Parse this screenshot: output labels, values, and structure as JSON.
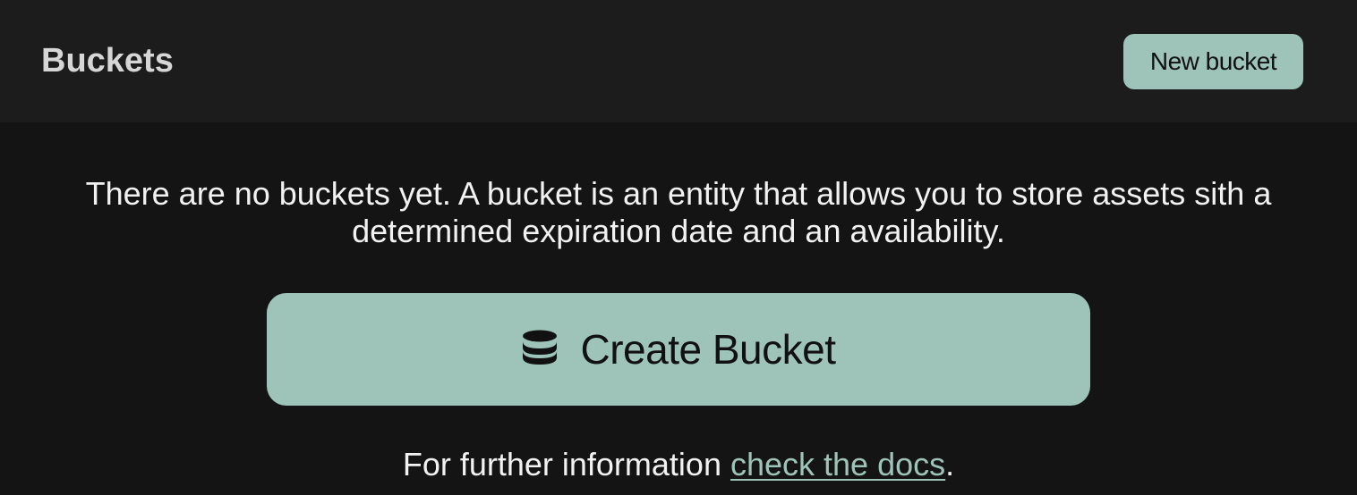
{
  "header": {
    "title": "Buckets",
    "new_bucket_label": "New bucket"
  },
  "empty_state": {
    "description": "There are no buckets yet. A bucket is an entity that allows you to store assets sith a determined expiration date and an availability.",
    "create_button_label": "Create Bucket",
    "create_button_icon": "database-icon",
    "footer_prefix": "For further information ",
    "docs_link_label": "check the docs",
    "footer_suffix": "."
  },
  "colors": {
    "accent": "#9ec4b9",
    "background": "#141414",
    "header_background": "#1c1c1c"
  }
}
